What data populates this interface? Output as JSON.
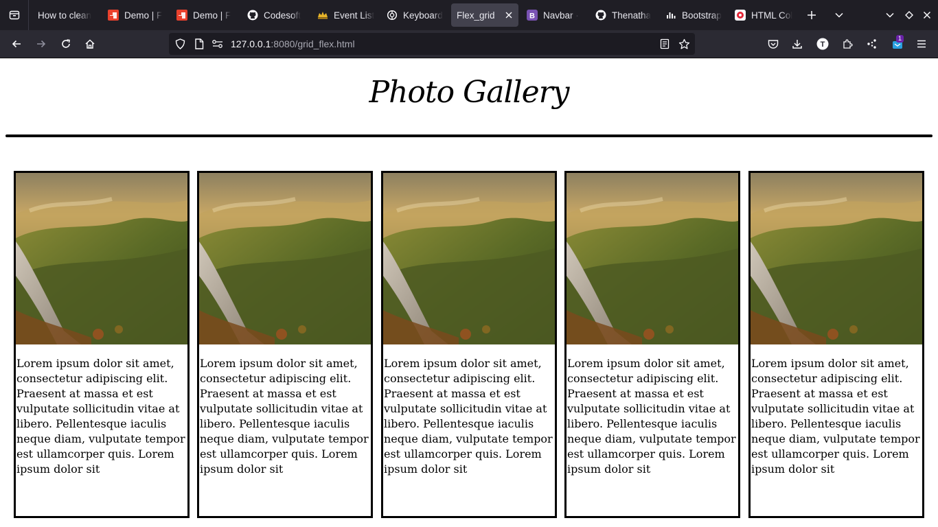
{
  "browser": {
    "tabs": [
      {
        "label": "How to clean",
        "icon": "page-icon"
      },
      {
        "label": "Demo | F",
        "icon": "demo-icon"
      },
      {
        "label": "Demo | F",
        "icon": "demo-icon"
      },
      {
        "label": "Codesoft",
        "icon": "github-icon"
      },
      {
        "label": "Event List",
        "icon": "crown-icon"
      },
      {
        "label": "Keyboard",
        "icon": "openai-icon"
      },
      {
        "label": "Flex_grid",
        "icon": "none",
        "active": true
      },
      {
        "label": "Navbar · ",
        "icon": "bootstrap-icon"
      },
      {
        "label": "Thenatha",
        "icon": "github-icon"
      },
      {
        "label": "Bootstrap",
        "icon": "chart-icon"
      },
      {
        "label": "HTML Col",
        "icon": "html-color-icon"
      }
    ],
    "url_host": "127.0.0.1",
    "url_rest": ":8080/grid_flex.html",
    "extension_badge": "1"
  },
  "page": {
    "title": "Photo Gallery",
    "cards": [
      {
        "text": "Lorem ipsum dolor sit amet, consectetur adipiscing elit. Praesent at massa et est vulputate sollicitudin vitae at libero. Pellentesque iaculis neque diam, vulputate tempor est ullamcorper quis. Lorem ipsum dolor sit"
      },
      {
        "text": "Lorem ipsum dolor sit amet, consectetur adipiscing elit. Praesent at massa et est vulputate sollicitudin vitae at libero. Pellentesque iaculis neque diam, vulputate tempor est ullamcorper quis. Lorem ipsum dolor sit"
      },
      {
        "text": "Lorem ipsum dolor sit amet, consectetur adipiscing elit. Praesent at massa et est vulputate sollicitudin vitae at libero. Pellentesque iaculis neque diam, vulputate tempor est ullamcorper quis. Lorem ipsum dolor sit"
      },
      {
        "text": "Lorem ipsum dolor sit amet, consectetur adipiscing elit. Praesent at massa et est vulputate sollicitudin vitae at libero. Pellentesque iaculis neque diam, vulputate tempor est ullamcorper quis. Lorem ipsum dolor sit"
      },
      {
        "text": "Lorem ipsum dolor sit amet, consectetur adipiscing elit. Praesent at massa et est vulputate sollicitudin vitae at libero. Pellentesque iaculis neque diam, vulputate tempor est ullamcorper quis. Lorem ipsum dolor sit"
      }
    ]
  },
  "colors": {
    "tabbar_bg": "#1f1e25",
    "toolbar_bg": "#2b2a33",
    "urlbar_bg": "#1c1b22",
    "active_tab_bg": "#42414d"
  }
}
